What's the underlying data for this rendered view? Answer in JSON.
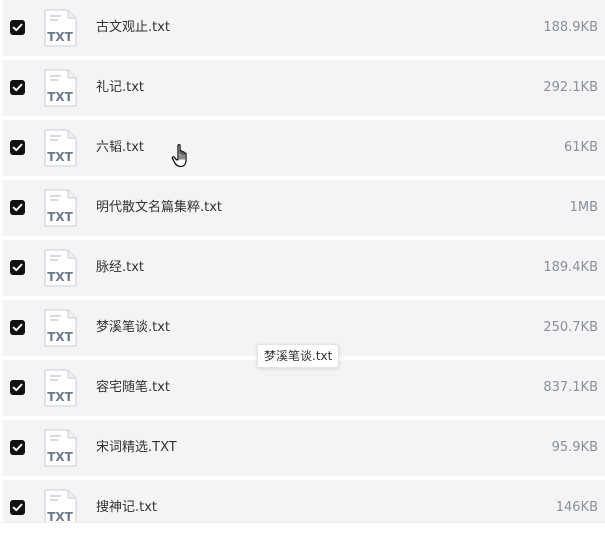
{
  "files": [
    {
      "name": "古文观止.txt",
      "size": "188.9KB",
      "type": "TXT",
      "checked": true
    },
    {
      "name": "礼记.txt",
      "size": "292.1KB",
      "type": "TXT",
      "checked": true
    },
    {
      "name": "六韬.txt",
      "size": "61KB",
      "type": "TXT",
      "checked": true
    },
    {
      "name": "明代散文名篇集粹.txt",
      "size": "1MB",
      "type": "TXT",
      "checked": true
    },
    {
      "name": "脉经.txt",
      "size": "189.4KB",
      "type": "TXT",
      "checked": true
    },
    {
      "name": "梦溪笔谈.txt",
      "size": "250.7KB",
      "type": "TXT",
      "checked": true
    },
    {
      "name": "容宅随笔.txt",
      "size": "837.1KB",
      "type": "TXT",
      "checked": true
    },
    {
      "name": "宋词精选.TXT",
      "size": "95.9KB",
      "type": "TXT",
      "checked": true
    },
    {
      "name": "搜神记.txt",
      "size": "146KB",
      "type": "TXT",
      "checked": true
    }
  ],
  "tooltip": {
    "text": "梦溪笔谈.txt"
  },
  "icons": {
    "checkbox": "checkbox-checked-icon",
    "file": "txt-file-icon",
    "cursor": "hand-pointer-icon"
  },
  "colors": {
    "row_background": "#f3f4f6",
    "checkbox": "#111111",
    "file_name": "#333333",
    "file_size": "#8a8f98",
    "icon_label": "#6b7a8c"
  }
}
